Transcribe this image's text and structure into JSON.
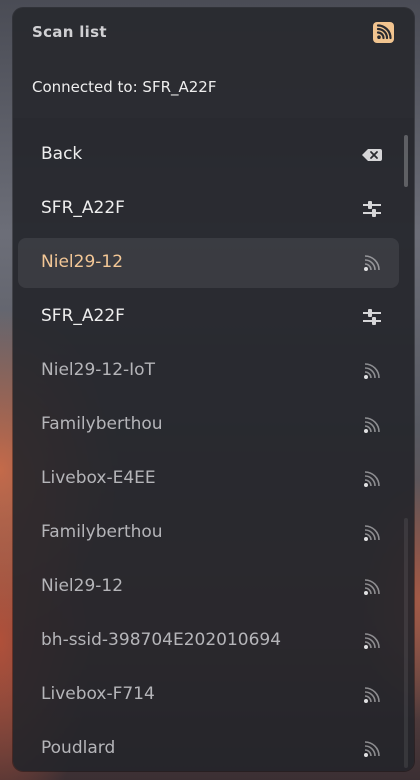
{
  "header": {
    "title": "Scan list",
    "connected_label": "Connected to: SFR_A22F"
  },
  "colors": {
    "accent_rss": "#f1c48f",
    "active_text": "#f3c796"
  },
  "list": {
    "items": [
      {
        "label": "Back",
        "icon": "backspace-icon"
      },
      {
        "label": "SFR_A22F",
        "icon": "settings-sliders-icon"
      },
      {
        "label": "Niel29-12",
        "icon": "wifi-signal-icon"
      },
      {
        "label": "SFR_A22F",
        "icon": "settings-sliders-icon"
      },
      {
        "label": "Niel29-12-IoT",
        "icon": "wifi-signal-icon"
      },
      {
        "label": "Familyberthou",
        "icon": "wifi-signal-icon"
      },
      {
        "label": "Livebox-E4EE",
        "icon": "wifi-signal-icon"
      },
      {
        "label": "Familyberthou",
        "icon": "wifi-signal-icon"
      },
      {
        "label": "Niel29-12",
        "icon": "wifi-signal-icon"
      },
      {
        "label": "bh-ssid-398704E202010694",
        "icon": "wifi-signal-icon"
      },
      {
        "label": "Livebox-F714",
        "icon": "wifi-signal-icon"
      },
      {
        "label": "Poudlard",
        "icon": "wifi-signal-icon"
      }
    ]
  }
}
